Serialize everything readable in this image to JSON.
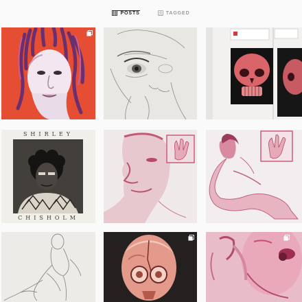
{
  "tabs": [
    {
      "label": "POSTS",
      "icon": "grid-icon",
      "active": true
    },
    {
      "label": "TAGGED",
      "icon": "tag-icon",
      "active": false
    }
  ],
  "posts": [
    {
      "subject": "red portrait with braids",
      "multi": true
    },
    {
      "subject": "pencil face sketch",
      "multi": false
    },
    {
      "subject": "red skull sketchbook",
      "multi": false
    },
    {
      "subject": "shirley chisholm etching",
      "multi": false
    },
    {
      "subject": "red face study",
      "multi": false
    },
    {
      "subject": "red figure study",
      "multi": false
    },
    {
      "subject": "seated figure pencil",
      "multi": true
    },
    {
      "subject": "child skull painting",
      "multi": true
    },
    {
      "subject": "red face closeup",
      "multi": false
    }
  ],
  "artwork_text": {
    "poster_top": "SHIRLEY",
    "poster_bottom": "CHISHOLM"
  },
  "colors": {
    "active_tab": "#262626",
    "inactive_tab": "#9a9a9a",
    "background": "#fafafa"
  }
}
